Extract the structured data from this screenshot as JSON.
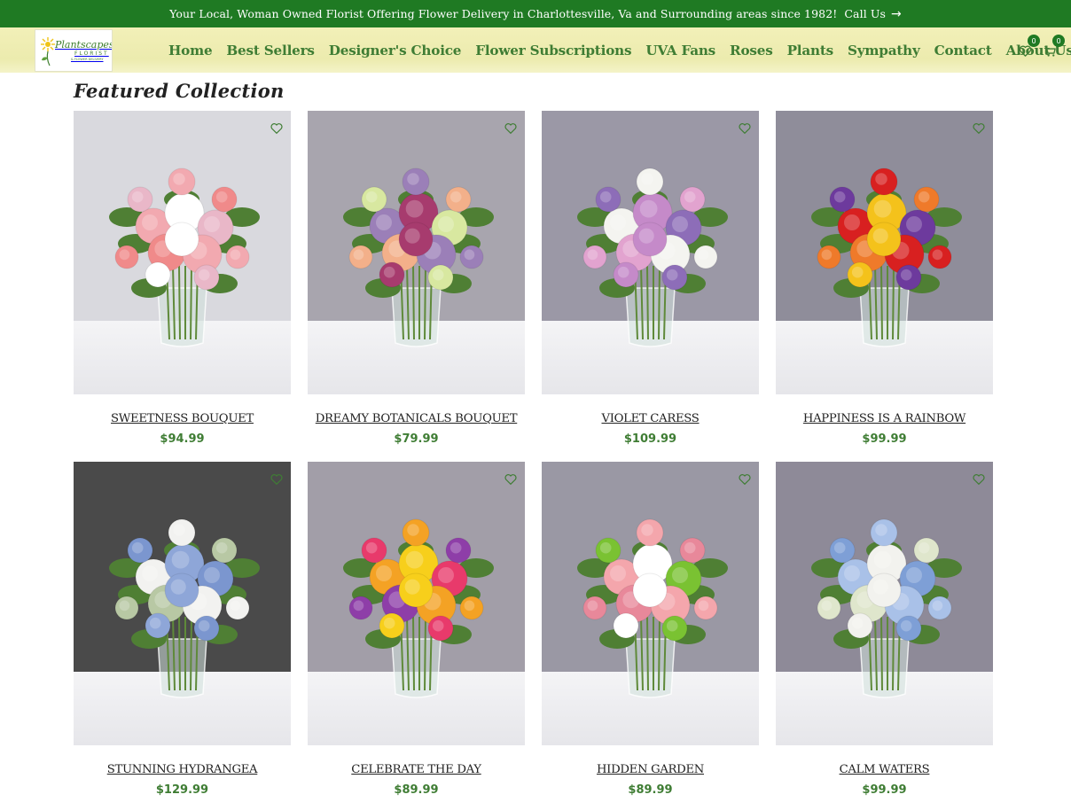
{
  "topbar": {
    "message": "Your Local, Woman Owned Florist Offering Flower Delivery in Charlottesville, Va and Surrounding areas since 1982!",
    "call_label": "Call Us",
    "arrow_icon": "arrow-right-icon"
  },
  "logo": {
    "script": "Plantscapes",
    "sub": "FLORIST",
    "tag": "& FLOWER DELIVERY"
  },
  "nav": {
    "items": [
      {
        "label": "Home"
      },
      {
        "label": "Best Sellers"
      },
      {
        "label": "Designer's Choice"
      },
      {
        "label": "Flower Subscriptions"
      },
      {
        "label": "UVA Fans"
      },
      {
        "label": "Roses"
      },
      {
        "label": "Plants"
      },
      {
        "label": "Sympathy"
      },
      {
        "label": "Contact"
      },
      {
        "label": "About Us"
      }
    ]
  },
  "header_icons": {
    "wishlist": {
      "icon": "heart-icon",
      "count": "0"
    },
    "cart": {
      "icon": "cart-icon",
      "count": "0"
    }
  },
  "section": {
    "title": "Featured Collection"
  },
  "products": [
    {
      "name": "SWEETNESS BOUQUET",
      "price": "$94.99",
      "wall": "#d9d9de",
      "flowers": [
        "#f2a9b0",
        "#ffffff",
        "#e9b7c8",
        "#f08a8a"
      ]
    },
    {
      "name": "DREAMY BOTANICALS BOUQUET",
      "price": "$79.99",
      "wall": "#a8a5ae",
      "flowers": [
        "#9b7fb8",
        "#a73b6e",
        "#d8e8a0",
        "#f3b08a"
      ]
    },
    {
      "name": "VIOLET CARESS",
      "price": "$109.99",
      "wall": "#9b98a6",
      "flowers": [
        "#f4f4f0",
        "#c58ac9",
        "#8d6db8",
        "#e2a3cf"
      ]
    },
    {
      "name": "HAPPINESS IS A RAINBOW",
      "price": "$99.99",
      "wall": "#8f8d9a",
      "flowers": [
        "#d82020",
        "#f4c21b",
        "#6d3a9d",
        "#ef7a2a"
      ]
    },
    {
      "name": "STUNNING HYDRANGEA",
      "price": "$129.99",
      "wall": "#4a4a4a",
      "flowers": [
        "#f2f2f0",
        "#8ea6d8",
        "#7b96cf",
        "#b8c8a4"
      ]
    },
    {
      "name": "CELEBRATE THE DAY",
      "price": "$89.99",
      "wall": "#a29ea8",
      "flowers": [
        "#f4a224",
        "#f7cf1b",
        "#e83a6b",
        "#8e3ea8"
      ]
    },
    {
      "name": "HIDDEN GARDEN",
      "price": "$89.99",
      "wall": "#9a98a4",
      "flowers": [
        "#f4a6ac",
        "#ffffff",
        "#7ac232",
        "#e8889a"
      ]
    },
    {
      "name": "CALM WATERS",
      "price": "$99.99",
      "wall": "#8e8a98",
      "flowers": [
        "#a9c1e8",
        "#f2f2ee",
        "#7e9fd6",
        "#dfe6cc"
      ]
    }
  ],
  "colors": {
    "brand_green": "#1f7a23",
    "nav_green": "#3f7d34",
    "header_bg": "#f2f0b8"
  }
}
